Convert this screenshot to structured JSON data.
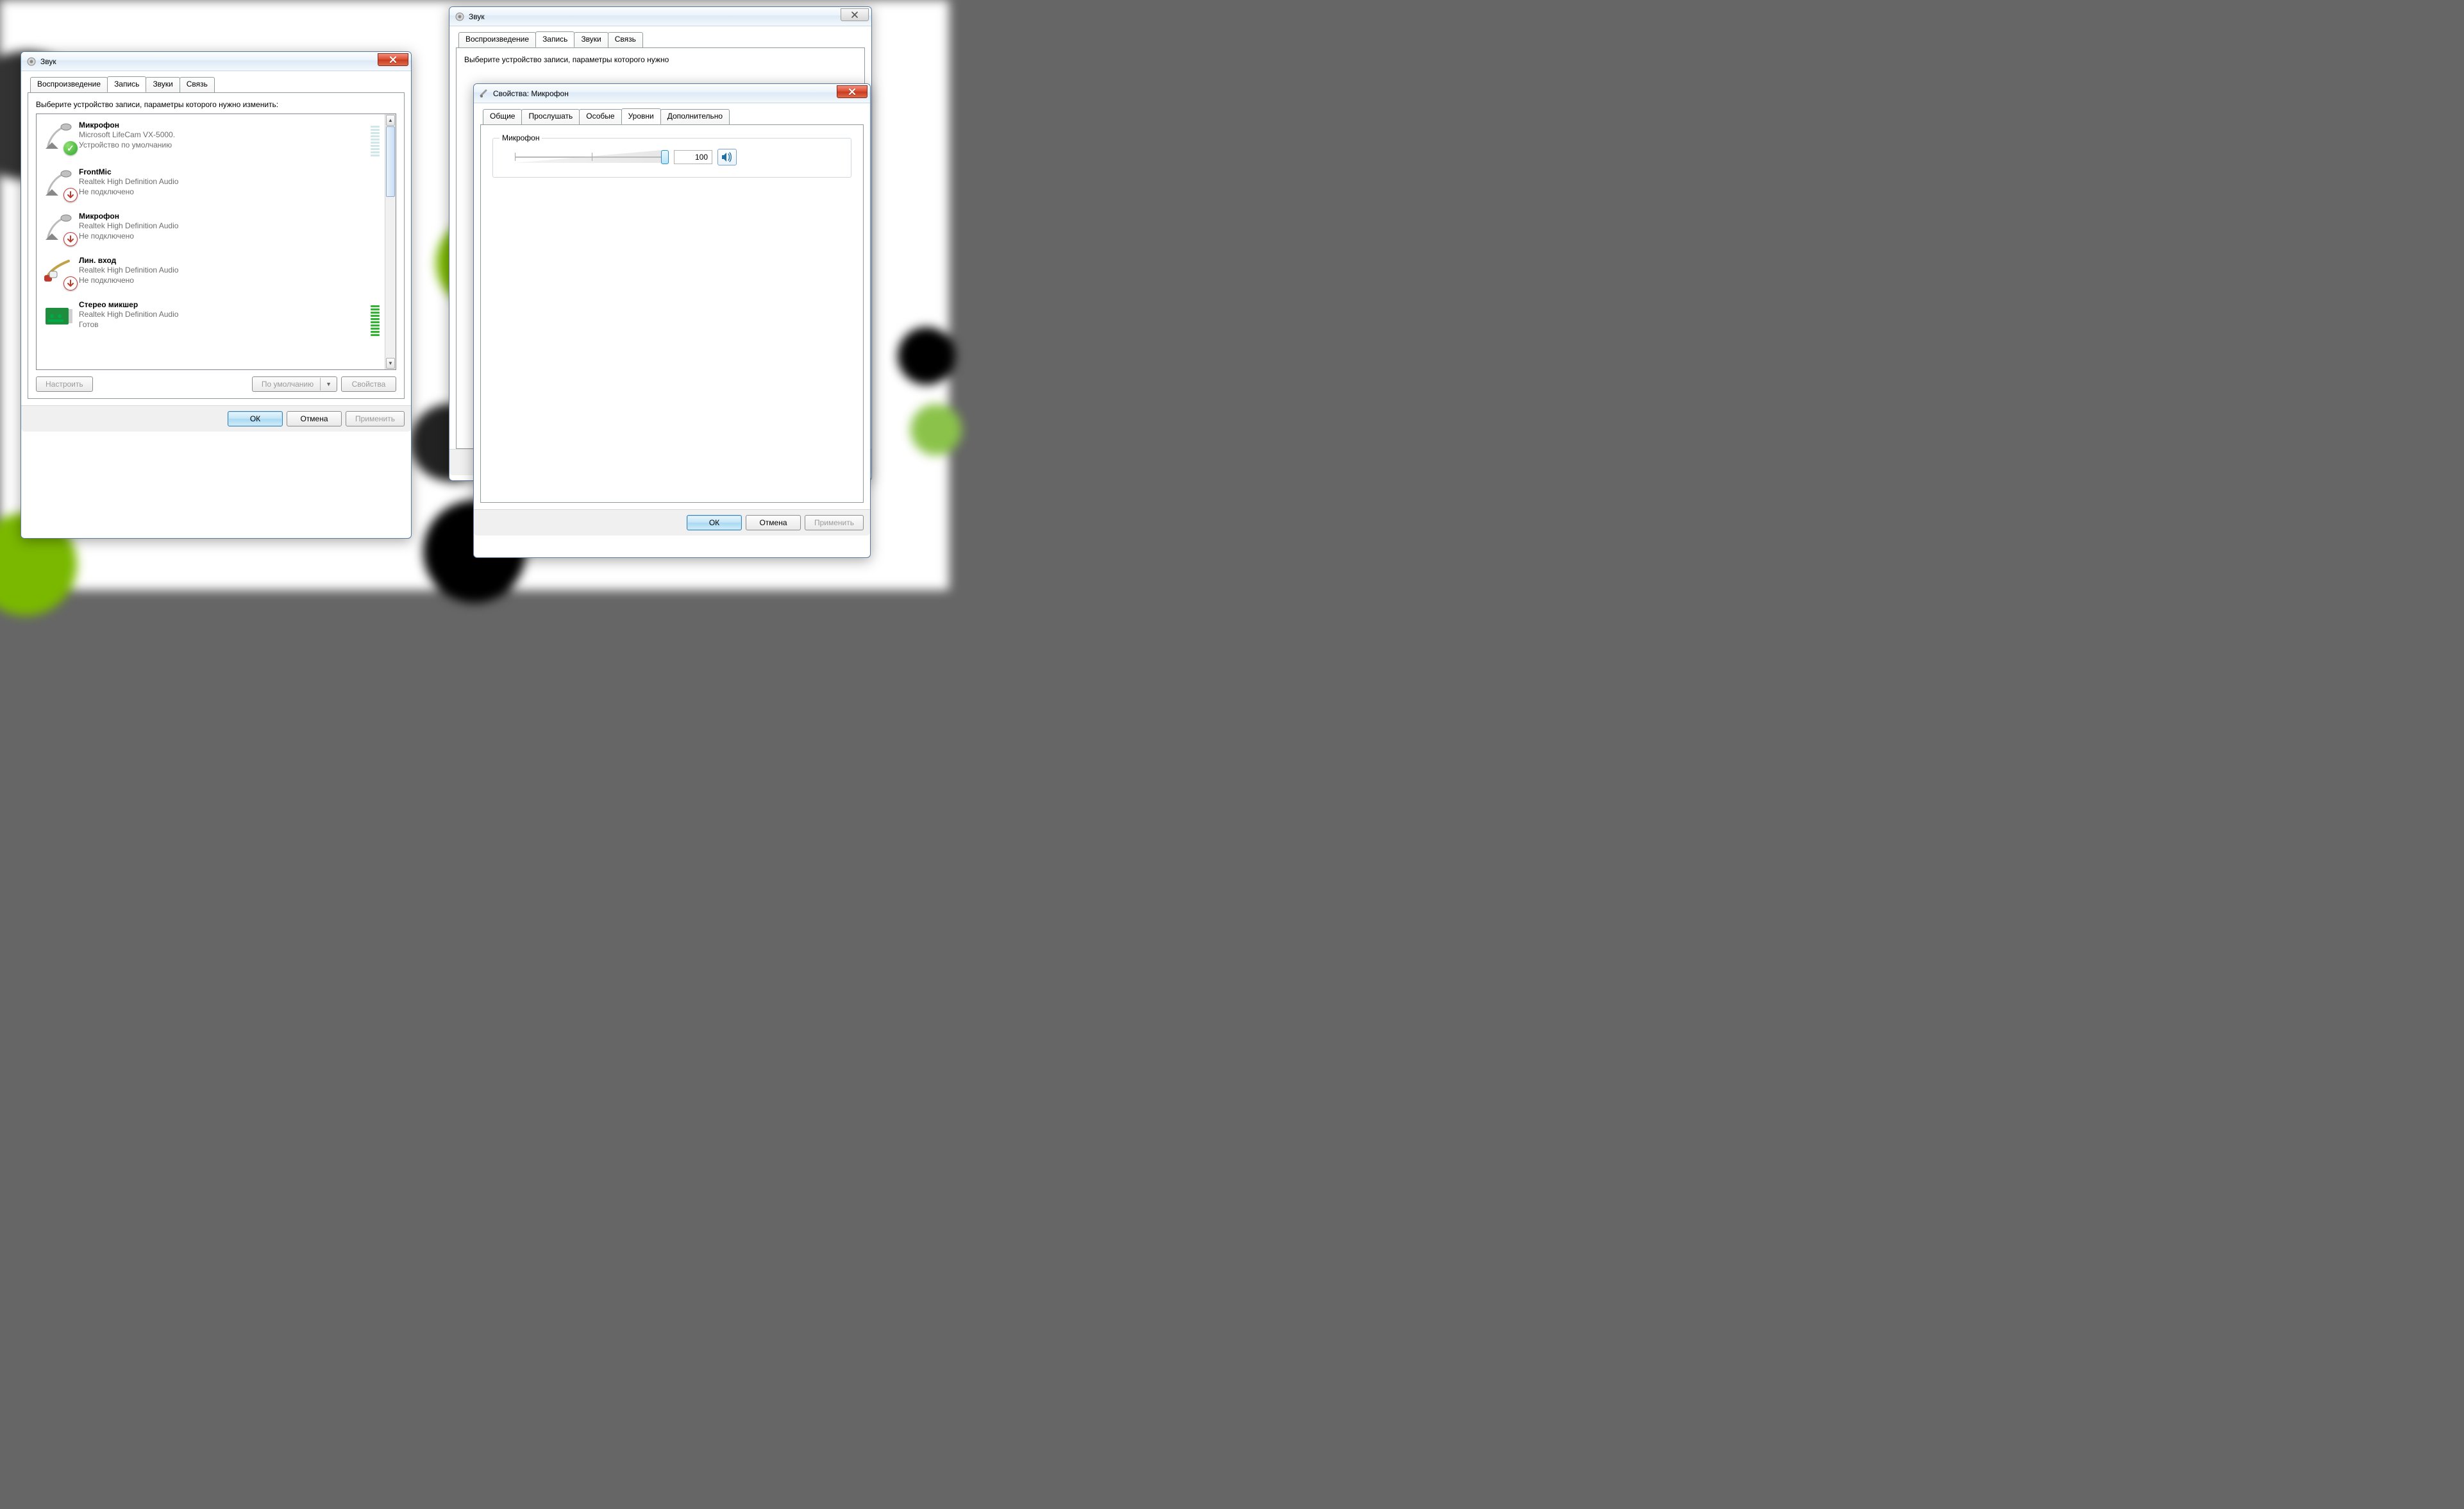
{
  "sound_dialog": {
    "title": "Звук",
    "tabs": {
      "playback": "Воспроизведение",
      "record": "Запись",
      "sounds": "Звуки",
      "comm": "Связь"
    },
    "active_tab": "record",
    "instructions": "Выберите устройство записи, параметры которого нужно изменить:",
    "devices": [
      {
        "name": "Микрофон",
        "line2": "Microsoft LifeCam VX-5000.",
        "line3": "Устройство по умолчанию",
        "badge": "default",
        "meter": "idle",
        "icon": "mic"
      },
      {
        "name": "FrontMic",
        "line2": "Realtek High Definition Audio",
        "line3": "Не подключено",
        "badge": "down",
        "meter": "none",
        "icon": "mic"
      },
      {
        "name": "Микрофон",
        "line2": "Realtek High Definition Audio",
        "line3": "Не подключено",
        "badge": "down",
        "meter": "none",
        "icon": "mic"
      },
      {
        "name": "Лин. вход",
        "line2": "Realtek High Definition Audio",
        "line3": "Не подключено",
        "badge": "down",
        "meter": "none",
        "icon": "linein"
      },
      {
        "name": "Стерео микшер",
        "line2": "Realtek High Definition Audio",
        "line3": "Готов",
        "badge": "",
        "meter": "active",
        "icon": "card"
      }
    ],
    "buttons": {
      "configure": "Настроить",
      "set_default": "По умолчанию",
      "properties": "Свойства",
      "ok": "ОК",
      "cancel": "Отмена",
      "apply": "Применить"
    }
  },
  "back_dialog": {
    "title": "Звук",
    "instructions_partial": "Выберите устройство записи, параметры которого нужно"
  },
  "props_dialog": {
    "title": "Свойства: Микрофон",
    "tabs": {
      "general": "Общие",
      "listen": "Прослушать",
      "custom": "Особые",
      "levels": "Уровни",
      "advanced": "Дополнительно"
    },
    "active_tab": "levels",
    "group_label": "Микрофон",
    "value": "100",
    "buttons": {
      "ok": "ОК",
      "cancel": "Отмена",
      "apply": "Применить"
    }
  }
}
